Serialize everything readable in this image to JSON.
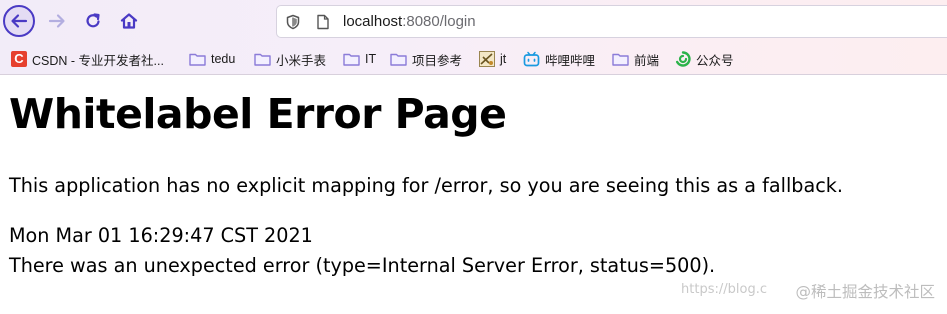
{
  "browser": {
    "url_host": "localhost",
    "url_rest": ":8080/login"
  },
  "bookmarks": [
    {
      "label": "CSDN - 专业开发者社...",
      "icon": "csdn-logo-icon"
    },
    {
      "label": "tedu",
      "icon": "folder-icon"
    },
    {
      "label": "小米手表",
      "icon": "folder-icon"
    },
    {
      "label": "IT",
      "icon": "folder-icon"
    },
    {
      "label": "项目参考",
      "icon": "folder-icon"
    },
    {
      "label": "jt",
      "icon": "jt-site-icon"
    },
    {
      "label": "哔哩哔哩",
      "icon": "bilibili-icon"
    },
    {
      "label": "前端",
      "icon": "folder-icon"
    },
    {
      "label": "公众号",
      "icon": "wechat-icon"
    }
  ],
  "page": {
    "title": "Whitelabel Error Page",
    "message": "This application has no explicit mapping for /error, so you are seeing this as a fallback.",
    "timestamp": "Mon Mar 01 16:29:47 CST 2021",
    "error": "There was an unexpected error (type=Internal Server Error, status=500)."
  },
  "watermark": {
    "url_fragment": "https://blog.c",
    "brand": "@稀土掘金技术社区"
  },
  "colors": {
    "accent": "#4a3ac4",
    "folder": "#8b7bd8",
    "csdn": "#e6402e"
  }
}
